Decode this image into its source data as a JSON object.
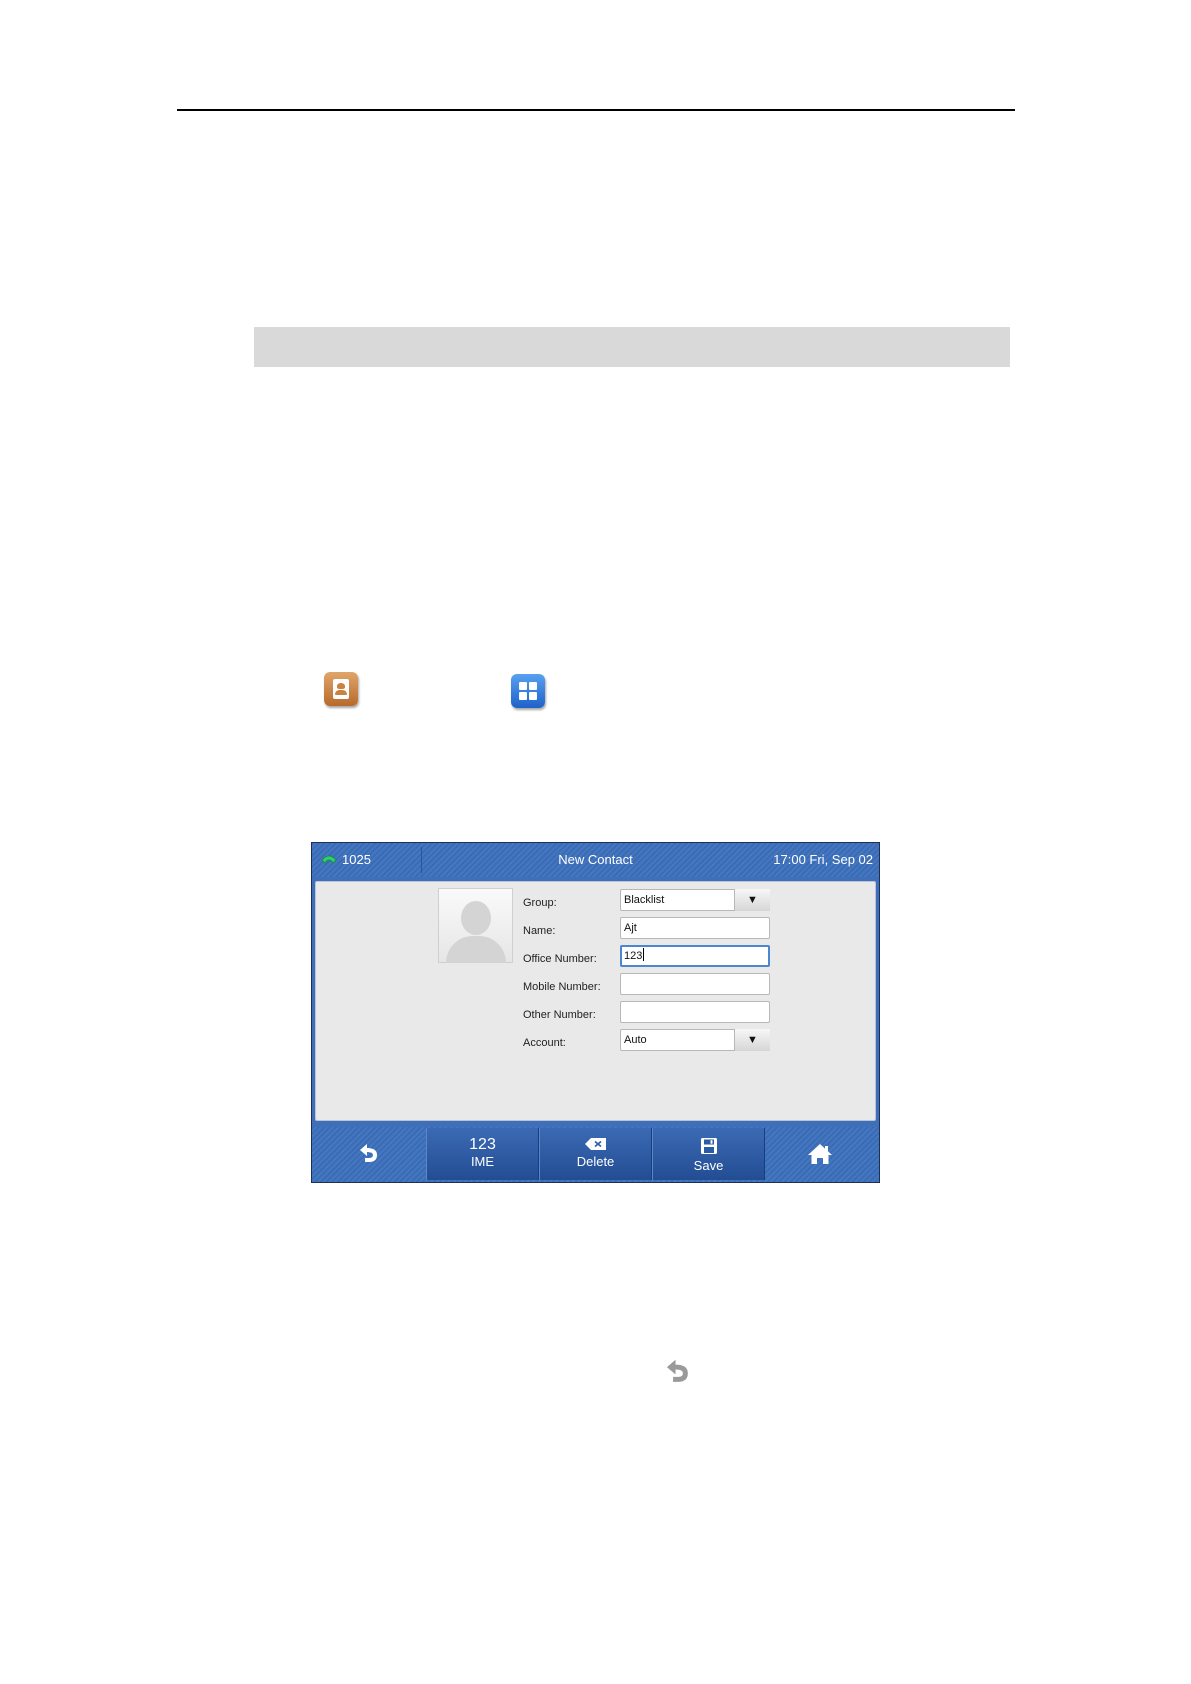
{
  "screen": {
    "status_bar": {
      "line_icon": "phone-handset-icon",
      "account": "1025",
      "title": "New Contact",
      "datetime": "17:00 Fri, Sep 02"
    },
    "form": {
      "fields": [
        {
          "label": "Group:",
          "value": "Blacklist",
          "type": "dropdown"
        },
        {
          "label": "Name:",
          "value": "Ajt",
          "type": "text"
        },
        {
          "label": "Office Number:",
          "value": "123",
          "type": "text",
          "focused": true
        },
        {
          "label": "Mobile Number:",
          "value": "",
          "type": "text"
        },
        {
          "label": "Other Number:",
          "value": "",
          "type": "text"
        },
        {
          "label": "Account:",
          "value": "Auto",
          "type": "dropdown"
        }
      ],
      "dropdown_arrow": "▼"
    },
    "softkeys": {
      "back_icon": "back-arrow-icon",
      "ime": {
        "top": "123",
        "label": "IME"
      },
      "delete": {
        "icon": "backspace-icon",
        "label": "Delete"
      },
      "save": {
        "icon": "floppy-disk-icon",
        "label": "Save"
      },
      "home_icon": "home-icon"
    }
  },
  "doc_icons": [
    "contacts-book-icon",
    "menu-grid-icon",
    "back-arrow-icon"
  ],
  "colors": {
    "screen_blue": "#3f6fb8",
    "contacts_icon": "#c9823f",
    "menu_icon": "#2f78e0",
    "focus_border": "#4b86d1"
  }
}
